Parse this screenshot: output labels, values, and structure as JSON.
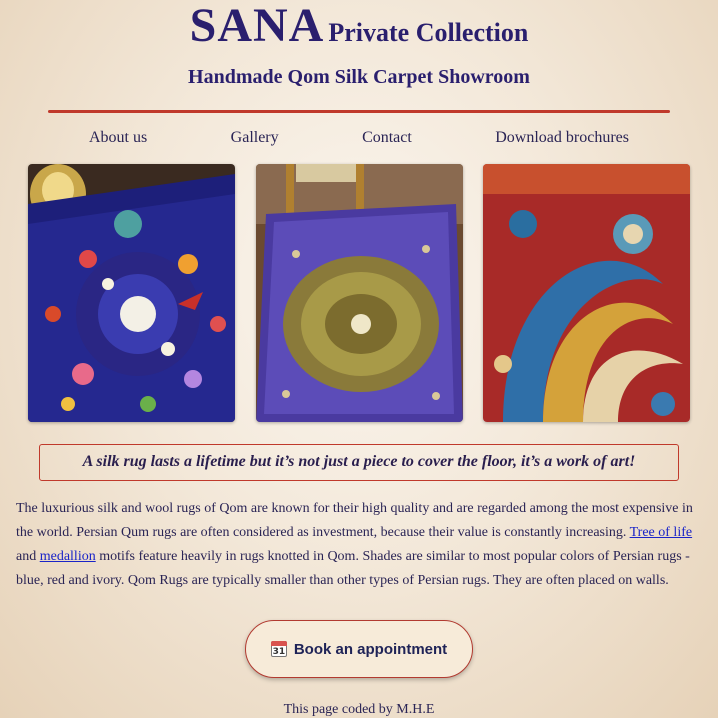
{
  "header": {
    "brand_main": "SANA",
    "brand_sub": "Private Collection",
    "subtitle": "Handmade Qom Silk Carpet Showroom"
  },
  "nav": {
    "items": [
      {
        "label": "About us"
      },
      {
        "label": "Gallery"
      },
      {
        "label": "Contact"
      },
      {
        "label": "Download brochures"
      }
    ]
  },
  "gallery": {
    "images": [
      {
        "icon": "floral-blue-silk-rug-image"
      },
      {
        "icon": "purple-medallion-silk-rug-image"
      },
      {
        "icon": "red-paisley-silk-rug-image"
      }
    ]
  },
  "quote": "A silk rug lasts a lifetime but it’s not just a piece to cover the floor, it’s a work of art!",
  "description": {
    "part1": "The luxurious silk and wool rugs of Qom are known for their high quality and are regarded among the most expensive in the world. Persian Qum rugs are often considered as investment, because their value is constantly increasing. ",
    "link1": "Tree of life",
    "part2": " and ",
    "link2": "medallion",
    "part3": " motifs feature heavily in rugs knotted in Qom. Shades are similar to most popular colors of Persian rugs - blue, red and ivory. Qom Rugs are typically smaller than other types of Persian rugs. They are often placed on walls."
  },
  "cta": {
    "icon": "calendar-icon",
    "icon_day": "31",
    "label": "Book an appointment"
  },
  "footer": "This page coded by M.H.E",
  "colors": {
    "accent_red": "#c0392b",
    "brand_navy": "#2a1f6e",
    "link_blue": "#1a24c8"
  }
}
